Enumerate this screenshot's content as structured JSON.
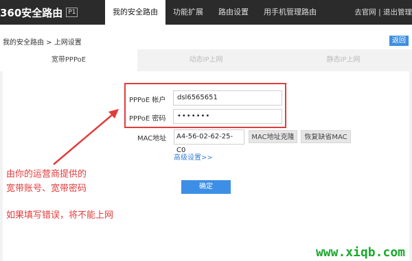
{
  "header": {
    "logo_text": "360安全路由",
    "logo_badge": "P1",
    "nav": [
      "我的安全路由",
      "功能扩展",
      "路由设置",
      "用手机管理路由"
    ],
    "right_links": [
      "去官网",
      "退出管理"
    ]
  },
  "breadcrumb": "我的安全路由 > 上网设置",
  "back_label": "返回",
  "tabs": [
    "宽带PPPoE",
    "动态IP上网",
    "静态IP上网"
  ],
  "form": {
    "account_label": "PPPoE 帐户",
    "account_value": "dsl6565651",
    "password_label": "PPPoE 密码",
    "password_value": "•••••••",
    "mac_label": "MAC地址",
    "mac_value": "A4-56-02-62-25-C0",
    "mac_clone_label": "MAC地址克隆",
    "mac_restore_label": "恢复缺省MAC",
    "advanced_label": "高级设置>>",
    "confirm_label": "确定"
  },
  "annotation": {
    "line1": "由你的运营商提供的",
    "line2": "宽带账号、宽带密码",
    "line3": "如果填写错误，将不能上网",
    "color": "#e23b3b"
  },
  "watermark": "www.xiqb.com"
}
